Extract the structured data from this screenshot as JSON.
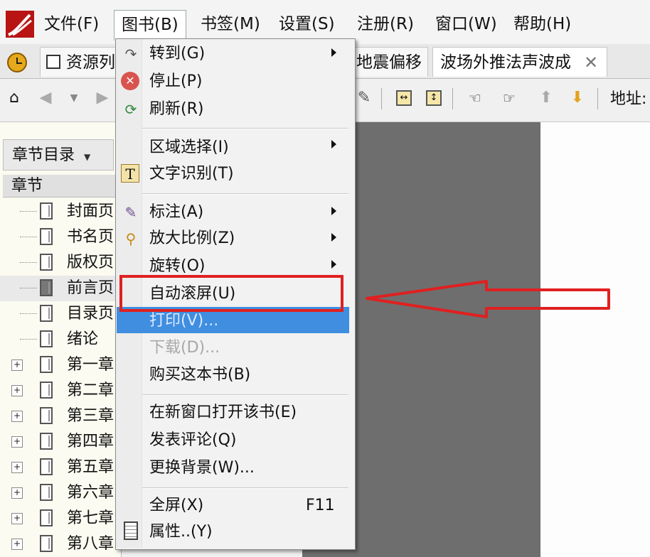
{
  "menubar": {
    "items": [
      {
        "label": "文件(F)"
      },
      {
        "label": "图书(B)"
      },
      {
        "label": "书签(M)"
      },
      {
        "label": "设置(S)"
      },
      {
        "label": "注册(R)"
      },
      {
        "label": "窗口(W)"
      },
      {
        "label": "帮助(H)"
      }
    ]
  },
  "tabs": [
    {
      "label": "资源列"
    },
    {
      "label": "地震偏移"
    },
    {
      "label": "波场外推法声波成"
    }
  ],
  "toolbar": {
    "address_label": "地址:"
  },
  "left_panel": {
    "dropdown_label": "章节目录",
    "tree_header": "章节",
    "rows": [
      {
        "label": "封面页"
      },
      {
        "label": "书名页"
      },
      {
        "label": "版权页"
      },
      {
        "label": "前言页"
      },
      {
        "label": "目录页"
      },
      {
        "label": "绪论"
      },
      {
        "label": "第一章"
      },
      {
        "label": "第二章"
      },
      {
        "label": "第三章"
      },
      {
        "label": "第四章"
      },
      {
        "label": "第五章"
      },
      {
        "label": "第六章"
      },
      {
        "label": "第七章"
      },
      {
        "label": "第八章"
      }
    ]
  },
  "book_menu": {
    "items": [
      {
        "label": "转到(G)",
        "icon": "goto-arrow-icon"
      },
      {
        "label": "停止(P)",
        "icon": "stop-icon"
      },
      {
        "label": "刷新(R)",
        "icon": "refresh-icon"
      },
      {
        "label": "区域选择(I)"
      },
      {
        "label": "文字识别(T)",
        "icon": "text-recognition-icon"
      },
      {
        "label": "标注(A)",
        "icon": "annotate-icon"
      },
      {
        "label": "放大比例(Z)",
        "icon": "zoom-icon"
      },
      {
        "label": "旋转(O)"
      },
      {
        "label": "自动滚屏(U)"
      },
      {
        "label": "打印(V)..."
      },
      {
        "label": "下载(D)..."
      },
      {
        "label": "购买这本书(B)"
      },
      {
        "label": "在新窗口打开该书(E)"
      },
      {
        "label": "发表评论(Q)"
      },
      {
        "label": "更换背景(W)..."
      },
      {
        "label": "全屏(X)",
        "shortcut": "F11"
      },
      {
        "label": "属性..(Y)",
        "icon": "properties-icon"
      }
    ]
  },
  "colors": {
    "highlight": "#3f8ee0",
    "annotation": "#e02020"
  }
}
